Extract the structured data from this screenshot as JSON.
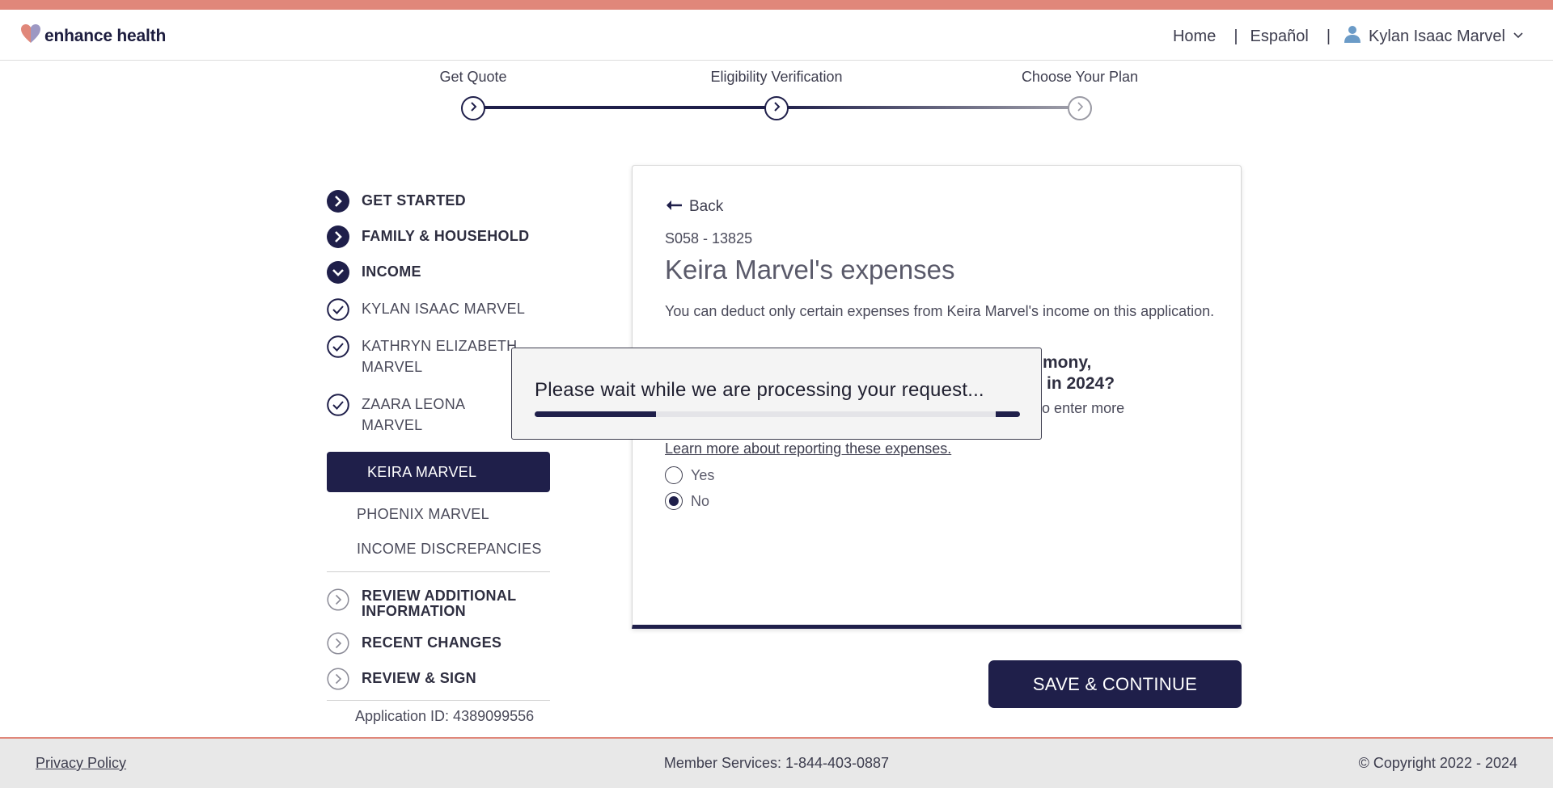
{
  "brand": {
    "name": "enhance health",
    "logo_icon": "heart-logo-icon"
  },
  "header": {
    "nav_home": "Home",
    "nav_language": "Español",
    "separator": "|",
    "user_name": "Kylan Isaac Marvel"
  },
  "stepper": {
    "steps": [
      {
        "label": "Get Quote",
        "status": "complete"
      },
      {
        "label": "Eligibility Verification",
        "status": "current"
      },
      {
        "label": "Choose Your Plan",
        "status": "upcoming"
      }
    ]
  },
  "sidebar": {
    "sections": [
      {
        "label": "GET STARTED",
        "status": "complete"
      },
      {
        "label": "FAMILY & HOUSEHOLD",
        "status": "complete"
      },
      {
        "label": "INCOME",
        "status": "expanded"
      }
    ],
    "income_members": [
      {
        "label": "KYLAN ISAAC MARVEL",
        "status": "checked"
      },
      {
        "label": "KATHRYN ELIZABETH MARVEL",
        "status": "checked"
      },
      {
        "label": "ZAARA LEONA MARVEL",
        "status": "checked"
      }
    ],
    "active_member": "KEIRA MARVEL",
    "pending_items": [
      "PHOENIX MARVEL",
      "INCOME DISCREPANCIES"
    ],
    "remaining_sections": [
      {
        "label": "REVIEW ADDITIONAL INFORMATION"
      },
      {
        "label": "RECENT CHANGES"
      },
      {
        "label": "REVIEW & SIGN"
      }
    ],
    "application_id": "Application ID: 4389099556"
  },
  "card": {
    "back_label": "Back",
    "code": "S058 - 13825",
    "title": "Keira Marvel's expenses",
    "description": "You can deduct only certain expenses from Keira Marvel's income on this application.",
    "question_tail_1": "t, alimony,",
    "question_tail_2": "in 2024?",
    "hint_tail": "e able to enter more",
    "learn_more": "Learn more about reporting these expenses.",
    "options": [
      {
        "label": "Yes",
        "selected": false
      },
      {
        "label": "No",
        "selected": true
      }
    ]
  },
  "save_button": "SAVE & CONTINUE",
  "modal": {
    "message": "Please wait while we are processing your request...",
    "progress_segments": [
      {
        "start": 0,
        "end": 0.25
      },
      {
        "start": 0.95,
        "end": 1.0
      }
    ]
  },
  "footer": {
    "privacy": "Privacy Policy",
    "member_services": "Member Services: 1-844-403-0887",
    "copyright": "© Copyright 2022 - 2024"
  },
  "colors": {
    "navy": "#1f1f4a",
    "accent_stripe": "#e0877a",
    "footer_bg": "#e8e8e8"
  }
}
